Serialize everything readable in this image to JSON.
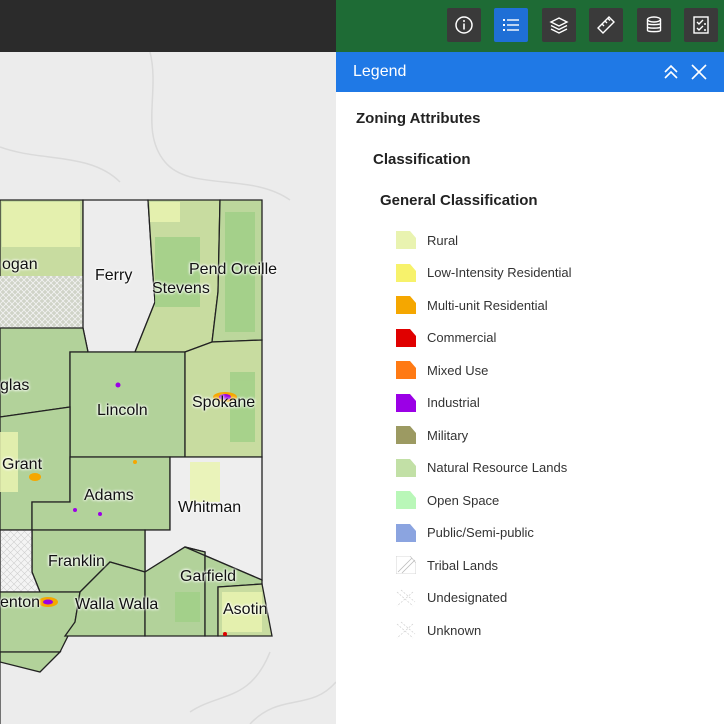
{
  "toolbar": {
    "buttons": [
      {
        "icon": "info-icon",
        "active": false
      },
      {
        "icon": "legend-list-icon",
        "active": true
      },
      {
        "icon": "layers-icon",
        "active": false
      },
      {
        "icon": "measure-ruler-icon",
        "active": false
      },
      {
        "icon": "database-icon",
        "active": false
      },
      {
        "icon": "checklist-icon",
        "active": false
      }
    ]
  },
  "panel": {
    "title": "Legend",
    "section": "Zoning Attributes",
    "subsection": "Classification",
    "group": "General Classification",
    "items": [
      {
        "label": "Rural",
        "color": "#e9f3b0",
        "pattern": "solid"
      },
      {
        "label": "Low-Intensity Residential",
        "color": "#f7f26b",
        "pattern": "solid"
      },
      {
        "label": "Multi-unit Residential",
        "color": "#f5a700",
        "pattern": "solid"
      },
      {
        "label": "Commercial",
        "color": "#e00000",
        "pattern": "solid"
      },
      {
        "label": "Mixed Use",
        "color": "#ff7a14",
        "pattern": "solid"
      },
      {
        "label": "Industrial",
        "color": "#9b00e6",
        "pattern": "solid"
      },
      {
        "label": "Military",
        "color": "#9c9a62",
        "pattern": "solid"
      },
      {
        "label": "Natural Resource Lands",
        "color": "#c2e0a6",
        "pattern": "solid"
      },
      {
        "label": "Open Space",
        "color": "#b9f7b8",
        "pattern": "solid"
      },
      {
        "label": "Public/Semi-public",
        "color": "#8ba4e0",
        "pattern": "solid"
      },
      {
        "label": "Tribal Lands",
        "color": "#dcdcdc",
        "pattern": "tribal"
      },
      {
        "label": "Undesignated",
        "color": "#dcdcdc",
        "pattern": "crosshatch"
      },
      {
        "label": "Unknown",
        "color": "#dcdcdc",
        "pattern": "crosshatch"
      }
    ]
  },
  "map": {
    "counties": [
      {
        "name": "ogan",
        "fill": "#c8dca0"
      },
      {
        "name": "Ferry",
        "fill": "#ededed"
      },
      {
        "name": "Stevens",
        "fill": "#c8dca0"
      },
      {
        "name": "Pend Oreille",
        "fill": "#c8dca0"
      },
      {
        "name": "glas",
        "fill": "#c8dca0"
      },
      {
        "name": "Lincoln",
        "fill": "#b2d29a"
      },
      {
        "name": "Spokane",
        "fill": "#c8dca0"
      },
      {
        "name": "Grant",
        "fill": "#b2d29a"
      },
      {
        "name": "Adams",
        "fill": "#b2d29a"
      },
      {
        "name": "Whitman",
        "fill": "#eeeeee"
      },
      {
        "name": "Franklin",
        "fill": "#b2d29a"
      },
      {
        "name": "Garfield",
        "fill": "#b2d29a"
      },
      {
        "name": "enton",
        "fill": "#b2d29a"
      },
      {
        "name": "Walla Walla",
        "fill": "#b2d29a"
      },
      {
        "name": "Asotin",
        "fill": "#c8dca0"
      }
    ]
  }
}
